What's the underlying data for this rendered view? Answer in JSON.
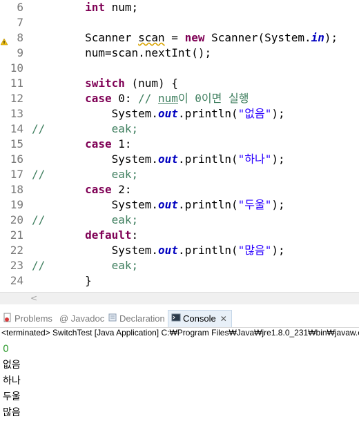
{
  "editor": {
    "lines": [
      {
        "num": "6",
        "prefix": "",
        "tokens": [
          [
            "",
            "        "
          ],
          [
            "kw",
            "int"
          ],
          [
            "",
            " num;"
          ]
        ]
      },
      {
        "num": "7",
        "prefix": "",
        "tokens": []
      },
      {
        "num": "8",
        "prefix": "",
        "tokens": [
          [
            "",
            "        Scanner "
          ],
          [
            "warn",
            "scan"
          ],
          [
            "",
            " = "
          ],
          [
            "kw",
            "new"
          ],
          [
            "",
            " Scanner(System."
          ],
          [
            "fld",
            "in"
          ],
          [
            "",
            ");"
          ]
        ]
      },
      {
        "num": "9",
        "prefix": "",
        "tokens": [
          [
            "",
            "        num=scan.nextInt();"
          ]
        ]
      },
      {
        "num": "10",
        "prefix": "",
        "tokens": []
      },
      {
        "num": "11",
        "prefix": "",
        "tokens": [
          [
            "",
            "        "
          ],
          [
            "kw",
            "switch"
          ],
          [
            "",
            " (num) {"
          ]
        ]
      },
      {
        "num": "12",
        "prefix": "",
        "tokens": [
          [
            "",
            "        "
          ],
          [
            "kw",
            "case"
          ],
          [
            "",
            " 0: "
          ],
          [
            "cm",
            "// "
          ],
          [
            "cmul",
            "num"
          ],
          [
            "cm",
            "이 0이면 실행"
          ]
        ]
      },
      {
        "num": "13",
        "prefix": "",
        "tokens": [
          [
            "",
            "            System."
          ],
          [
            "fld",
            "out"
          ],
          [
            "",
            ".println("
          ],
          [
            "str",
            "\"없음\""
          ],
          [
            "",
            ");"
          ]
        ]
      },
      {
        "num": "14",
        "prefix": "//",
        "tokens": [
          [
            "",
            "            "
          ],
          [
            "cm",
            "break;"
          ]
        ]
      },
      {
        "num": "15",
        "prefix": "",
        "tokens": [
          [
            "",
            "        "
          ],
          [
            "kw",
            "case"
          ],
          [
            "",
            " 1:"
          ]
        ]
      },
      {
        "num": "16",
        "prefix": "",
        "tokens": [
          [
            "",
            "            System."
          ],
          [
            "fld",
            "out"
          ],
          [
            "",
            ".println("
          ],
          [
            "str",
            "\"하나\""
          ],
          [
            "",
            ");"
          ]
        ]
      },
      {
        "num": "17",
        "prefix": "//",
        "tokens": [
          [
            "",
            "            "
          ],
          [
            "cm",
            "break;"
          ]
        ]
      },
      {
        "num": "18",
        "prefix": "",
        "tokens": [
          [
            "",
            "        "
          ],
          [
            "kw",
            "case"
          ],
          [
            "",
            " 2:"
          ]
        ]
      },
      {
        "num": "19",
        "prefix": "",
        "tokens": [
          [
            "",
            "            System."
          ],
          [
            "fld",
            "out"
          ],
          [
            "",
            ".println("
          ],
          [
            "str",
            "\"두울\""
          ],
          [
            "",
            ");"
          ]
        ]
      },
      {
        "num": "20",
        "prefix": "//",
        "tokens": [
          [
            "",
            "            "
          ],
          [
            "cm",
            "break;"
          ]
        ]
      },
      {
        "num": "21",
        "prefix": "",
        "tokens": [
          [
            "",
            "        "
          ],
          [
            "kw",
            "default"
          ],
          [
            "",
            ":"
          ]
        ]
      },
      {
        "num": "22",
        "prefix": "",
        "tokens": [
          [
            "",
            "            System."
          ],
          [
            "fld",
            "out"
          ],
          [
            "",
            ".println("
          ],
          [
            "str",
            "\"많음\""
          ],
          [
            "",
            ");"
          ]
        ]
      },
      {
        "num": "23",
        "prefix": "//",
        "tokens": [
          [
            "",
            "            "
          ],
          [
            "cm",
            "break;"
          ]
        ]
      },
      {
        "num": "24",
        "prefix": "",
        "tokens": [
          [
            "",
            "        }"
          ]
        ]
      }
    ],
    "warning_line": "8"
  },
  "tabs": [
    {
      "label": "Problems",
      "icon": "problems-icon",
      "active": false
    },
    {
      "label": "@ Javadoc",
      "icon": "javadoc-icon",
      "active": false
    },
    {
      "label": "Declaration",
      "icon": "declaration-icon",
      "active": false
    },
    {
      "label": "Console",
      "icon": "console-icon",
      "active": true,
      "close": "✕"
    }
  ],
  "console": {
    "status": "<terminated> SwitchTest [Java Application] C:₩Program Files₩Java₩jre1.8.0_231₩bin₩javaw.exe",
    "input": "0",
    "output": [
      "없음",
      "하나",
      "두울",
      "많음"
    ]
  },
  "colors": {
    "keyword": "#7f0055",
    "comment": "#3f7f5f",
    "string": "#2a00ff",
    "field": "#0000c0",
    "line_number": "#787878",
    "console_input": "#2e9b2e"
  }
}
